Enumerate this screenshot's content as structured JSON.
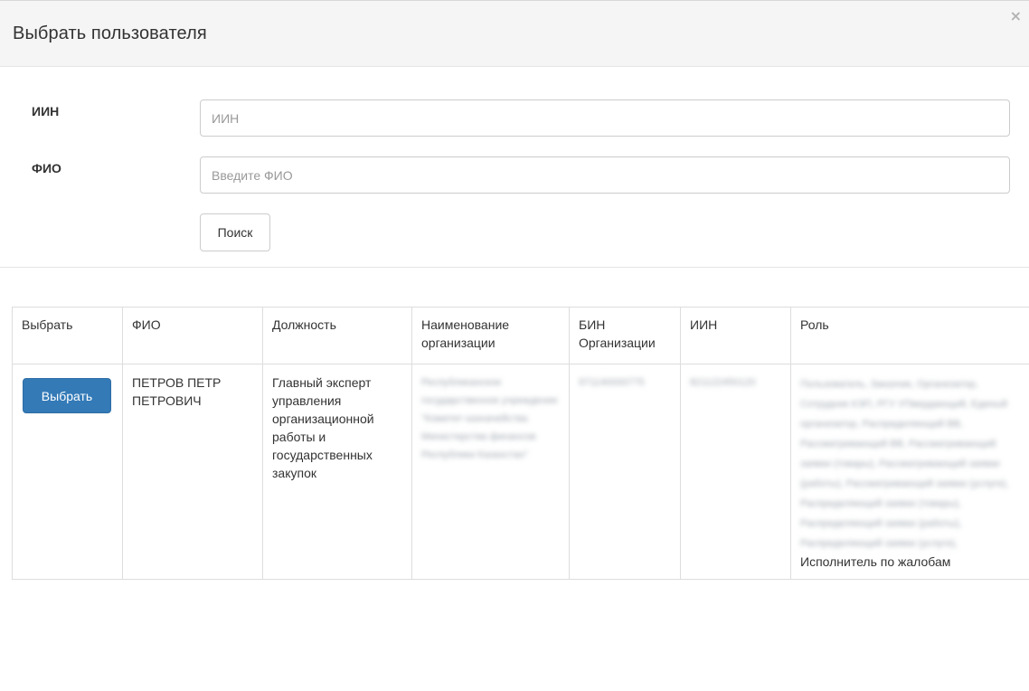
{
  "modal": {
    "title": "Выбрать пользователя",
    "close_symbol": "×"
  },
  "form": {
    "iin_label": "ИИН",
    "iin_placeholder": "ИИН",
    "iin_value": "",
    "fio_label": "ФИО",
    "fio_placeholder": "Введите ФИО",
    "fio_value": "",
    "search_label": "Поиск"
  },
  "table": {
    "headers": [
      "Выбрать",
      "ФИО",
      "Должность",
      "Наименование организации",
      "БИН Организации",
      "ИИН",
      "Роль"
    ],
    "rows": [
      {
        "select_label": "Выбрать",
        "fio": "ПЕТРОВ ПЕТР ПЕТРОВИЧ",
        "position": "Главный эксперт управления организационной работы и государственных закупок",
        "organization_redacted": "Республиканское государственное учреждение \"Комитет казначейства Министерства финансов Республики Казахстан\"",
        "bin_redacted": "971140000775",
        "iin_redacted": "821122450120",
        "role_redacted": "Пользователь, Заказчик, Организатор, Сотрудник КЭП, РГУ УПвердающий, Единый организатор, Распределяющий ВВ, Рассматривающий ВВ, Рассматривающий заявки (товары), Рассматривающий заявки (работы), Рассматривающий заявки (услуги), Распределяющий заявки (товары), Распределяющий заявки (работы), Распределяющий заявки (услуги),",
        "role_visible": "Исполнитель по жалобам"
      }
    ]
  }
}
